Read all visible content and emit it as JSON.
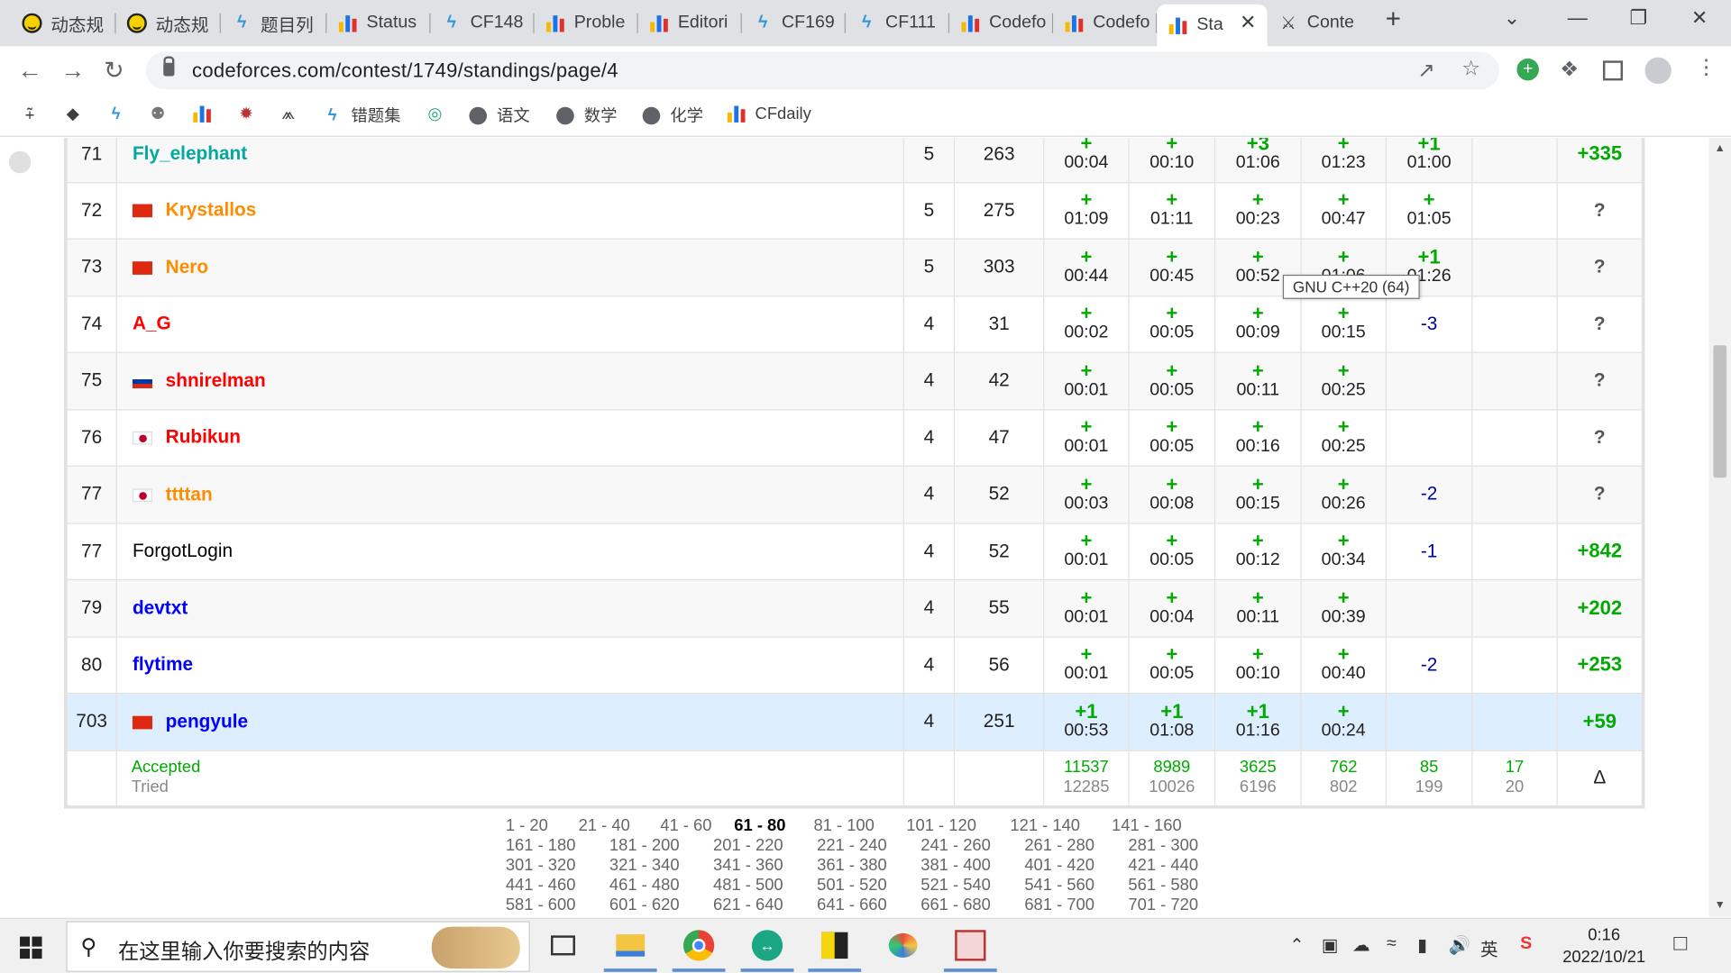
{
  "browser": {
    "tabs": [
      {
        "label": "动态规",
        "icon": "smiley-icon"
      },
      {
        "label": "动态规",
        "icon": "smiley-icon"
      },
      {
        "label": "题目列",
        "icon": "luogu-icon"
      },
      {
        "label": "Status",
        "icon": "codeforces-icon"
      },
      {
        "label": "CF148",
        "icon": "luogu-icon"
      },
      {
        "label": "Proble",
        "icon": "codeforces-icon"
      },
      {
        "label": "Editori",
        "icon": "codeforces-icon"
      },
      {
        "label": "CF169",
        "icon": "luogu-icon"
      },
      {
        "label": "CF111",
        "icon": "luogu-icon"
      },
      {
        "label": "Codefo",
        "icon": "codeforces-icon"
      },
      {
        "label": "Codefo",
        "icon": "codeforces-icon"
      },
      {
        "label": "Sta",
        "icon": "codeforces-icon",
        "active": true
      },
      {
        "label": "Conte",
        "icon": "logo-icon"
      }
    ],
    "url": "codeforces.com/contest/1749/standings/page/4",
    "bookmarks": [
      {
        "label": "",
        "icon": "bookmark-icon-1"
      },
      {
        "label": "",
        "icon": "graduation-cap-icon"
      },
      {
        "label": "",
        "icon": "luogu-icon"
      },
      {
        "label": "",
        "icon": "owl-icon"
      },
      {
        "label": "",
        "icon": "codeforces-icon"
      },
      {
        "label": "",
        "icon": "badge-icon"
      },
      {
        "label": "",
        "icon": "node-icon"
      },
      {
        "label": "错题集",
        "icon": "luogu-icon"
      },
      {
        "label": "",
        "icon": "atcoder-icon"
      },
      {
        "label": "语文",
        "icon": "globe-icon"
      },
      {
        "label": "数学",
        "icon": "globe-icon"
      },
      {
        "label": "化学",
        "icon": "globe-icon"
      },
      {
        "label": "CFdaily",
        "icon": "codeforces-icon"
      }
    ]
  },
  "standings": {
    "rows": [
      {
        "rank": "71",
        "handle": "Fly_elephant",
        "flag": "",
        "color": "cyan",
        "solved": "5",
        "penalty": "263",
        "problems": [
          {
            "mark": "+",
            "time": "00:04"
          },
          {
            "mark": "+",
            "time": "00:10"
          },
          {
            "mark": "+3",
            "time": "01:06"
          },
          {
            "mark": "+",
            "time": "01:23"
          },
          {
            "mark": "+1",
            "time": "01:00"
          },
          {
            "mark": "",
            "time": ""
          }
        ],
        "delta": "+335"
      },
      {
        "rank": "72",
        "handle": "Krystallos",
        "flag": "cn",
        "color": "orange",
        "solved": "5",
        "penalty": "275",
        "problems": [
          {
            "mark": "+",
            "time": "01:09"
          },
          {
            "mark": "+",
            "time": "01:11"
          },
          {
            "mark": "+",
            "time": "00:23"
          },
          {
            "mark": "+",
            "time": "00:47"
          },
          {
            "mark": "+",
            "time": "01:05"
          },
          {
            "mark": "",
            "time": ""
          }
        ],
        "delta": "?"
      },
      {
        "rank": "73",
        "handle": "Nero",
        "flag": "cn",
        "color": "orange",
        "solved": "5",
        "penalty": "303",
        "problems": [
          {
            "mark": "+",
            "time": "00:44"
          },
          {
            "mark": "+",
            "time": "00:45"
          },
          {
            "mark": "+",
            "time": "00:52"
          },
          {
            "mark": "+",
            "time": "01:06"
          },
          {
            "mark": "+1",
            "time": "01:26"
          },
          {
            "mark": "",
            "time": ""
          }
        ],
        "delta": "?"
      },
      {
        "rank": "74",
        "handle": "A_G",
        "flag": "",
        "color": "red",
        "solved": "4",
        "penalty": "31",
        "problems": [
          {
            "mark": "+",
            "time": "00:02"
          },
          {
            "mark": "+",
            "time": "00:05"
          },
          {
            "mark": "+",
            "time": "00:09"
          },
          {
            "mark": "+",
            "time": "00:15"
          },
          {
            "mark": "-3",
            "time": ""
          },
          {
            "mark": "",
            "time": ""
          }
        ],
        "delta": "?"
      },
      {
        "rank": "75",
        "handle": "shnirelman",
        "flag": "ru",
        "color": "red",
        "solved": "4",
        "penalty": "42",
        "problems": [
          {
            "mark": "+",
            "time": "00:01"
          },
          {
            "mark": "+",
            "time": "00:05"
          },
          {
            "mark": "+",
            "time": "00:11"
          },
          {
            "mark": "+",
            "time": "00:25"
          },
          {
            "mark": "",
            "time": ""
          },
          {
            "mark": "",
            "time": ""
          }
        ],
        "delta": "?"
      },
      {
        "rank": "76",
        "handle": "Rubikun",
        "flag": "jp",
        "color": "red",
        "solved": "4",
        "penalty": "47",
        "problems": [
          {
            "mark": "+",
            "time": "00:01"
          },
          {
            "mark": "+",
            "time": "00:05"
          },
          {
            "mark": "+",
            "time": "00:16"
          },
          {
            "mark": "+",
            "time": "00:25"
          },
          {
            "mark": "",
            "time": ""
          },
          {
            "mark": "",
            "time": ""
          }
        ],
        "delta": "?"
      },
      {
        "rank": "77",
        "handle": "ttttan",
        "flag": "jp",
        "color": "orange",
        "solved": "4",
        "penalty": "52",
        "problems": [
          {
            "mark": "+",
            "time": "00:03"
          },
          {
            "mark": "+",
            "time": "00:08"
          },
          {
            "mark": "+",
            "time": "00:15"
          },
          {
            "mark": "+",
            "time": "00:26"
          },
          {
            "mark": "-2",
            "time": ""
          },
          {
            "mark": "",
            "time": ""
          }
        ],
        "delta": "?"
      },
      {
        "rank": "77",
        "handle": "ForgotLogin",
        "flag": "",
        "color": "black",
        "solved": "4",
        "penalty": "52",
        "problems": [
          {
            "mark": "+",
            "time": "00:01"
          },
          {
            "mark": "+",
            "time": "00:05"
          },
          {
            "mark": "+",
            "time": "00:12"
          },
          {
            "mark": "+",
            "time": "00:34"
          },
          {
            "mark": "-1",
            "time": ""
          },
          {
            "mark": "",
            "time": ""
          }
        ],
        "delta": "+842"
      },
      {
        "rank": "79",
        "handle": "devtxt",
        "flag": "",
        "color": "blue",
        "solved": "4",
        "penalty": "55",
        "problems": [
          {
            "mark": "+",
            "time": "00:01"
          },
          {
            "mark": "+",
            "time": "00:04"
          },
          {
            "mark": "+",
            "time": "00:11"
          },
          {
            "mark": "+",
            "time": "00:39"
          },
          {
            "mark": "",
            "time": ""
          },
          {
            "mark": "",
            "time": ""
          }
        ],
        "delta": "+202"
      },
      {
        "rank": "80",
        "handle": "flytime",
        "flag": "",
        "color": "blue",
        "solved": "4",
        "penalty": "56",
        "problems": [
          {
            "mark": "+",
            "time": "00:01"
          },
          {
            "mark": "+",
            "time": "00:05"
          },
          {
            "mark": "+",
            "time": "00:10"
          },
          {
            "mark": "+",
            "time": "00:40"
          },
          {
            "mark": "-2",
            "time": ""
          },
          {
            "mark": "",
            "time": ""
          }
        ],
        "delta": "+253"
      },
      {
        "rank": "703",
        "handle": "pengyule",
        "flag": "cn",
        "color": "blue",
        "solved": "4",
        "penalty": "251",
        "highlight": true,
        "problems": [
          {
            "mark": "+1",
            "time": "00:53"
          },
          {
            "mark": "+1",
            "time": "01:08"
          },
          {
            "mark": "+1",
            "time": "01:16"
          },
          {
            "mark": "+",
            "time": "00:24"
          },
          {
            "mark": "",
            "time": ""
          },
          {
            "mark": "",
            "time": ""
          }
        ],
        "delta": "+59"
      }
    ],
    "footer": {
      "accepted_label": "Accepted",
      "tried_label": "Tried",
      "accepted": [
        "11537",
        "8989",
        "3625",
        "762",
        "85",
        "17"
      ],
      "tried": [
        "12285",
        "10026",
        "6196",
        "802",
        "199",
        "20"
      ],
      "delta_symbol": "Δ"
    },
    "tooltip": "GNU C++20 (64)"
  },
  "pagination": [
    [
      "1 - 20",
      "21 - 40",
      "41 - 60",
      "61 - 80",
      "81 - 100",
      "101 - 120",
      "121 - 140",
      "141 - 160"
    ],
    [
      "161 - 180",
      "181 - 200",
      "201 - 220",
      "221 - 240",
      "241 - 260",
      "261 - 280",
      "281 - 300"
    ],
    [
      "301 - 320",
      "321 - 340",
      "341 - 360",
      "361 - 380",
      "381 - 400",
      "401 - 420",
      "421 - 440"
    ],
    [
      "441 - 460",
      "461 - 480",
      "481 - 500",
      "501 - 520",
      "521 - 540",
      "541 - 560",
      "561 - 580"
    ],
    [
      "581 - 600",
      "601 - 620",
      "621 - 640",
      "641 - 660",
      "661 - 680",
      "681 - 700",
      "701 - 720"
    ]
  ],
  "pagination_current": "61 - 80",
  "taskbar": {
    "search_placeholder": "在这里输入你要搜索的内容",
    "time": "0:16",
    "date": "2022/10/21",
    "ime": "英"
  },
  "colors": {
    "accepted": "#00aa00",
    "rejected": "#0000aa",
    "highlight_row": "#ddeeff"
  }
}
